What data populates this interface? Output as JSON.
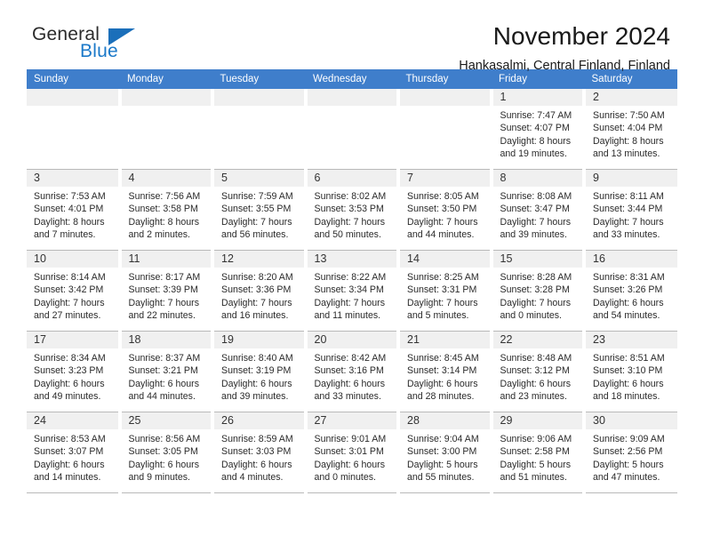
{
  "brand": {
    "name_part1": "General",
    "name_part2": "Blue",
    "triangle_color": "#1b6fba",
    "blue_color": "#1b79c9"
  },
  "header": {
    "title": "November 2024",
    "location": "Hankasalmi, Central Finland, Finland"
  },
  "theme": {
    "header_bg": "#3f7ecb",
    "daynum_bg": "#f0f0f0",
    "grid_line": "#b9b9b9"
  },
  "weekdays": [
    "Sunday",
    "Monday",
    "Tuesday",
    "Wednesday",
    "Thursday",
    "Friday",
    "Saturday"
  ],
  "weeks": [
    [
      {
        "day": "",
        "sunrise": "",
        "sunset": "",
        "daylight_line1": "",
        "daylight_line2": ""
      },
      {
        "day": "",
        "sunrise": "",
        "sunset": "",
        "daylight_line1": "",
        "daylight_line2": ""
      },
      {
        "day": "",
        "sunrise": "",
        "sunset": "",
        "daylight_line1": "",
        "daylight_line2": ""
      },
      {
        "day": "",
        "sunrise": "",
        "sunset": "",
        "daylight_line1": "",
        "daylight_line2": ""
      },
      {
        "day": "",
        "sunrise": "",
        "sunset": "",
        "daylight_line1": "",
        "daylight_line2": ""
      },
      {
        "day": "1",
        "sunrise": "Sunrise: 7:47 AM",
        "sunset": "Sunset: 4:07 PM",
        "daylight_line1": "Daylight: 8 hours",
        "daylight_line2": "and 19 minutes."
      },
      {
        "day": "2",
        "sunrise": "Sunrise: 7:50 AM",
        "sunset": "Sunset: 4:04 PM",
        "daylight_line1": "Daylight: 8 hours",
        "daylight_line2": "and 13 minutes."
      }
    ],
    [
      {
        "day": "3",
        "sunrise": "Sunrise: 7:53 AM",
        "sunset": "Sunset: 4:01 PM",
        "daylight_line1": "Daylight: 8 hours",
        "daylight_line2": "and 7 minutes."
      },
      {
        "day": "4",
        "sunrise": "Sunrise: 7:56 AM",
        "sunset": "Sunset: 3:58 PM",
        "daylight_line1": "Daylight: 8 hours",
        "daylight_line2": "and 2 minutes."
      },
      {
        "day": "5",
        "sunrise": "Sunrise: 7:59 AM",
        "sunset": "Sunset: 3:55 PM",
        "daylight_line1": "Daylight: 7 hours",
        "daylight_line2": "and 56 minutes."
      },
      {
        "day": "6",
        "sunrise": "Sunrise: 8:02 AM",
        "sunset": "Sunset: 3:53 PM",
        "daylight_line1": "Daylight: 7 hours",
        "daylight_line2": "and 50 minutes."
      },
      {
        "day": "7",
        "sunrise": "Sunrise: 8:05 AM",
        "sunset": "Sunset: 3:50 PM",
        "daylight_line1": "Daylight: 7 hours",
        "daylight_line2": "and 44 minutes."
      },
      {
        "day": "8",
        "sunrise": "Sunrise: 8:08 AM",
        "sunset": "Sunset: 3:47 PM",
        "daylight_line1": "Daylight: 7 hours",
        "daylight_line2": "and 39 minutes."
      },
      {
        "day": "9",
        "sunrise": "Sunrise: 8:11 AM",
        "sunset": "Sunset: 3:44 PM",
        "daylight_line1": "Daylight: 7 hours",
        "daylight_line2": "and 33 minutes."
      }
    ],
    [
      {
        "day": "10",
        "sunrise": "Sunrise: 8:14 AM",
        "sunset": "Sunset: 3:42 PM",
        "daylight_line1": "Daylight: 7 hours",
        "daylight_line2": "and 27 minutes."
      },
      {
        "day": "11",
        "sunrise": "Sunrise: 8:17 AM",
        "sunset": "Sunset: 3:39 PM",
        "daylight_line1": "Daylight: 7 hours",
        "daylight_line2": "and 22 minutes."
      },
      {
        "day": "12",
        "sunrise": "Sunrise: 8:20 AM",
        "sunset": "Sunset: 3:36 PM",
        "daylight_line1": "Daylight: 7 hours",
        "daylight_line2": "and 16 minutes."
      },
      {
        "day": "13",
        "sunrise": "Sunrise: 8:22 AM",
        "sunset": "Sunset: 3:34 PM",
        "daylight_line1": "Daylight: 7 hours",
        "daylight_line2": "and 11 minutes."
      },
      {
        "day": "14",
        "sunrise": "Sunrise: 8:25 AM",
        "sunset": "Sunset: 3:31 PM",
        "daylight_line1": "Daylight: 7 hours",
        "daylight_line2": "and 5 minutes."
      },
      {
        "day": "15",
        "sunrise": "Sunrise: 8:28 AM",
        "sunset": "Sunset: 3:28 PM",
        "daylight_line1": "Daylight: 7 hours",
        "daylight_line2": "and 0 minutes."
      },
      {
        "day": "16",
        "sunrise": "Sunrise: 8:31 AM",
        "sunset": "Sunset: 3:26 PM",
        "daylight_line1": "Daylight: 6 hours",
        "daylight_line2": "and 54 minutes."
      }
    ],
    [
      {
        "day": "17",
        "sunrise": "Sunrise: 8:34 AM",
        "sunset": "Sunset: 3:23 PM",
        "daylight_line1": "Daylight: 6 hours",
        "daylight_line2": "and 49 minutes."
      },
      {
        "day": "18",
        "sunrise": "Sunrise: 8:37 AM",
        "sunset": "Sunset: 3:21 PM",
        "daylight_line1": "Daylight: 6 hours",
        "daylight_line2": "and 44 minutes."
      },
      {
        "day": "19",
        "sunrise": "Sunrise: 8:40 AM",
        "sunset": "Sunset: 3:19 PM",
        "daylight_line1": "Daylight: 6 hours",
        "daylight_line2": "and 39 minutes."
      },
      {
        "day": "20",
        "sunrise": "Sunrise: 8:42 AM",
        "sunset": "Sunset: 3:16 PM",
        "daylight_line1": "Daylight: 6 hours",
        "daylight_line2": "and 33 minutes."
      },
      {
        "day": "21",
        "sunrise": "Sunrise: 8:45 AM",
        "sunset": "Sunset: 3:14 PM",
        "daylight_line1": "Daylight: 6 hours",
        "daylight_line2": "and 28 minutes."
      },
      {
        "day": "22",
        "sunrise": "Sunrise: 8:48 AM",
        "sunset": "Sunset: 3:12 PM",
        "daylight_line1": "Daylight: 6 hours",
        "daylight_line2": "and 23 minutes."
      },
      {
        "day": "23",
        "sunrise": "Sunrise: 8:51 AM",
        "sunset": "Sunset: 3:10 PM",
        "daylight_line1": "Daylight: 6 hours",
        "daylight_line2": "and 18 minutes."
      }
    ],
    [
      {
        "day": "24",
        "sunrise": "Sunrise: 8:53 AM",
        "sunset": "Sunset: 3:07 PM",
        "daylight_line1": "Daylight: 6 hours",
        "daylight_line2": "and 14 minutes."
      },
      {
        "day": "25",
        "sunrise": "Sunrise: 8:56 AM",
        "sunset": "Sunset: 3:05 PM",
        "daylight_line1": "Daylight: 6 hours",
        "daylight_line2": "and 9 minutes."
      },
      {
        "day": "26",
        "sunrise": "Sunrise: 8:59 AM",
        "sunset": "Sunset: 3:03 PM",
        "daylight_line1": "Daylight: 6 hours",
        "daylight_line2": "and 4 minutes."
      },
      {
        "day": "27",
        "sunrise": "Sunrise: 9:01 AM",
        "sunset": "Sunset: 3:01 PM",
        "daylight_line1": "Daylight: 6 hours",
        "daylight_line2": "and 0 minutes."
      },
      {
        "day": "28",
        "sunrise": "Sunrise: 9:04 AM",
        "sunset": "Sunset: 3:00 PM",
        "daylight_line1": "Daylight: 5 hours",
        "daylight_line2": "and 55 minutes."
      },
      {
        "day": "29",
        "sunrise": "Sunrise: 9:06 AM",
        "sunset": "Sunset: 2:58 PM",
        "daylight_line1": "Daylight: 5 hours",
        "daylight_line2": "and 51 minutes."
      },
      {
        "day": "30",
        "sunrise": "Sunrise: 9:09 AM",
        "sunset": "Sunset: 2:56 PM",
        "daylight_line1": "Daylight: 5 hours",
        "daylight_line2": "and 47 minutes."
      }
    ]
  ]
}
